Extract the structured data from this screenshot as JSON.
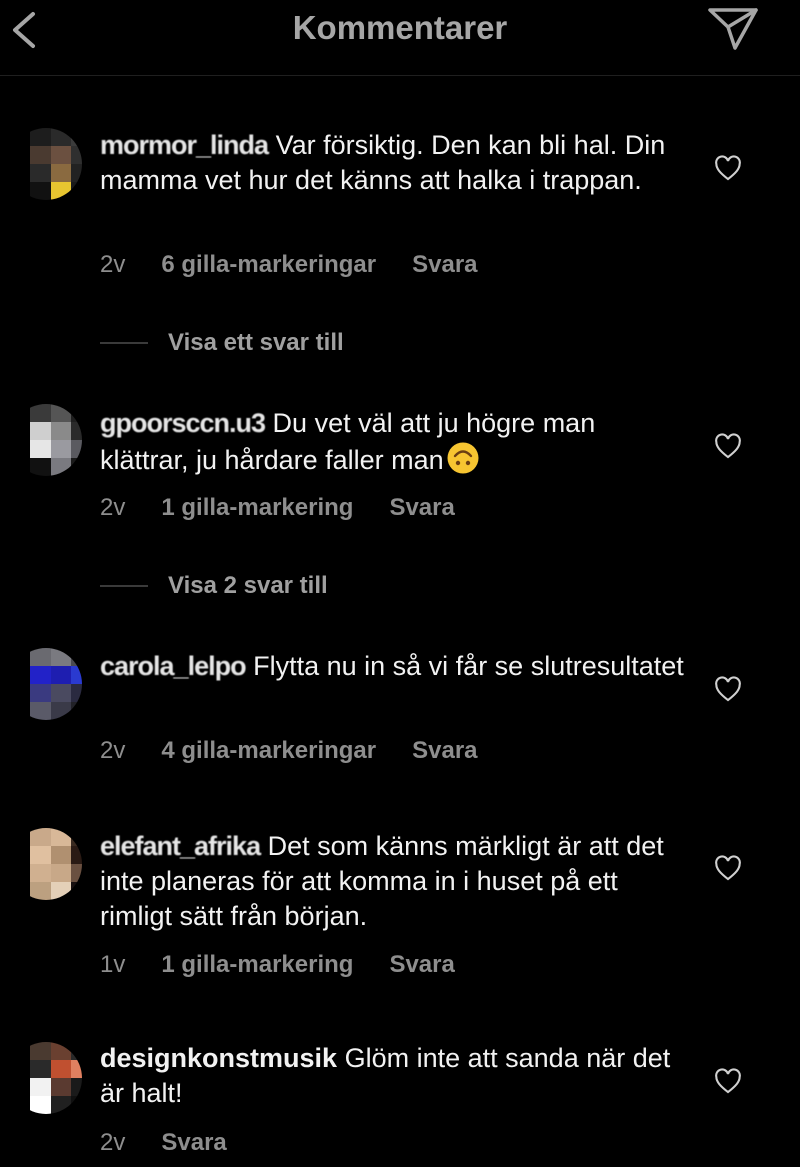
{
  "header": {
    "title": "Kommentarer",
    "back_icon": "chevron-left-icon",
    "send_icon": "paper-plane-icon"
  },
  "comments": [
    {
      "username": "mormor_linda",
      "text": "Var försiktig. Den kan bli hal. Din mamma vet hur det känns att halka i trappan.",
      "time": "2v",
      "likes": "6 gilla-markeringar",
      "reply": "Svara",
      "more_replies": "Visa ett svar till",
      "avatar_colors": [
        "#1d1d1d",
        "#2a2a2a",
        "#3b3b3b",
        "#4a3a30",
        "#6b5040",
        "#2f2f2f",
        "#2a2a2a",
        "#8a6a40",
        "#222222",
        "#111111",
        "#e8c530",
        "#1a1a1a"
      ]
    },
    {
      "username": "gpoorsccn.u3",
      "text": "Du vet väl att ju högre man klättrar, ju hårdare faller man",
      "emoji": "upside-down-face",
      "time": "2v",
      "likes": "1 gilla-markering",
      "reply": "Svara",
      "more_replies": "Visa 2 svar till",
      "avatar_colors": [
        "#3a3a3a",
        "#555555",
        "#1f1f1f",
        "#cfcfcf",
        "#8a8a8a",
        "#2a2a2a",
        "#e6e6e6",
        "#9a9aa0",
        "#5a5a60",
        "#111111",
        "#7a7a80",
        "#1a1a1a"
      ]
    },
    {
      "username": "carola_lelpo",
      "text": "Flytta nu in så vi får se slutresultatet",
      "time": "2v",
      "likes": "4 gilla-markeringar",
      "reply": "Svara",
      "avatar_colors": [
        "#6a6a70",
        "#7a7a80",
        "#4a4a50",
        "#2222c8",
        "#1e1eb0",
        "#2a3ad0",
        "#3a3a80",
        "#4a4a60",
        "#2a2a40",
        "#5a5a68",
        "#3a3a48",
        "#222228"
      ]
    },
    {
      "username": "elefant_afrika",
      "text": "Det som känns märkligt är att det inte planeras för att komma in i huset på ett rimligt sätt från början.",
      "time": "1v",
      "likes": "1 gilla-markering",
      "reply": "Svara",
      "avatar_colors": [
        "#c9a98a",
        "#d8b898",
        "#3a2a20",
        "#e0c0a0",
        "#b09070",
        "#2a1a14",
        "#d0b090",
        "#c8a888",
        "#6a5040",
        "#bca080",
        "#e4d0b8",
        "#181010"
      ]
    },
    {
      "username": "designkonstmusik",
      "text": "Glöm inte att sanda när det är halt!",
      "time": "2v",
      "reply": "Svara",
      "avatar_colors": [
        "#4a3a30",
        "#6a4030",
        "#2a2a2a",
        "#2a2a2a",
        "#c05030",
        "#e08060",
        "#f2f2f2",
        "#5a3a30",
        "#1a1a1a",
        "#ffffff",
        "#202020",
        "#101010"
      ]
    }
  ]
}
